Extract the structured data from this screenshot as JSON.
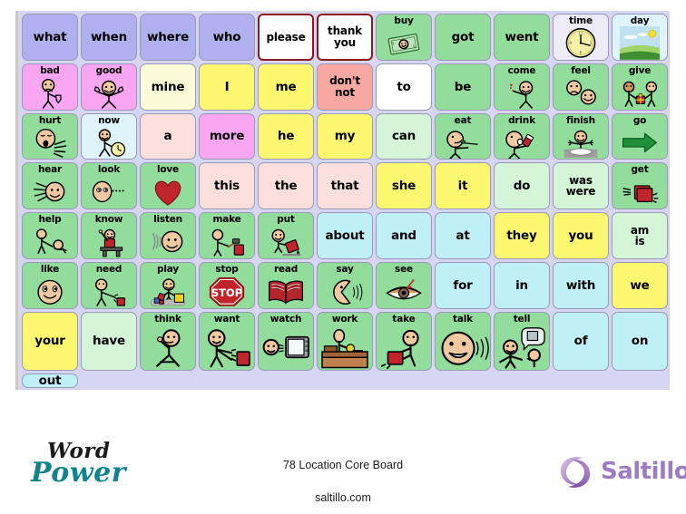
{
  "board": {
    "title": "78 Location Core  Board",
    "url": "saltillo.com",
    "wordpower": {
      "line1": "Word",
      "line2": "Power"
    },
    "brand": {
      "name": "Saltillo"
    },
    "colors": {
      "panel_bg": "#d6d6f2",
      "pronoun_purple": "#b0b0ee",
      "pronoun_yellow": "#fbf86f",
      "pronoun_cream": "#fbfbd8",
      "negation_pink": "#f7a8a3",
      "verb_green": "#92dc9c",
      "helper_green": "#d4f5d8",
      "white": "#ffffff",
      "prep_blue": "#bff0f8",
      "demonstrative_pink": "#fadfdc",
      "descriptor_magenta": "#f8a6f2",
      "time_lavender": "#ecebf7",
      "sky_blue": "#dff3fb",
      "highlight_border": "#8b1a1a"
    },
    "rows": [
      [
        {
          "label": "what",
          "color": "#b0b0ee",
          "pic": null
        },
        {
          "label": "when",
          "color": "#b0b0ee",
          "pic": null
        },
        {
          "label": "where",
          "color": "#b0b0ee",
          "pic": null
        },
        {
          "label": "who",
          "color": "#b0b0ee",
          "pic": null
        },
        {
          "label": "please",
          "color": "#ffffff",
          "pic": null,
          "highlight": true,
          "small": true
        },
        {
          "label": "thank\nyou",
          "color": "#ffffff",
          "pic": null,
          "highlight": true,
          "small": true
        },
        {
          "label": "buy",
          "color": "#92dc9c",
          "pic": "money"
        },
        {
          "label": "got",
          "color": "#92dc9c",
          "pic": null
        },
        {
          "label": "went",
          "color": "#92dc9c",
          "pic": null
        },
        {
          "label": "time",
          "color": "#ecebf7",
          "pic": "clock"
        },
        {
          "label": "day",
          "color": "#dff3fb",
          "pic": "landscape"
        },
        {
          "label": "bad",
          "color": "#f8a6f2",
          "pic": "thumbs-down-person"
        },
        {
          "label": "good",
          "color": "#f8a6f2",
          "pic": "thumbs-up-person"
        }
      ],
      [
        {
          "label": "mine",
          "color": "#fbfbd8",
          "pic": null
        },
        {
          "label": "I",
          "color": "#fbf86f",
          "pic": null
        },
        {
          "label": "me",
          "color": "#fbf86f",
          "pic": null
        },
        {
          "label": "don't\nnot",
          "color": "#f7a8a3",
          "pic": null,
          "small": true
        },
        {
          "label": "to",
          "color": "#ffffff",
          "pic": null
        },
        {
          "label": "be",
          "color": "#92dc9c",
          "pic": null
        },
        {
          "label": "come",
          "color": "#92dc9c",
          "pic": "come-person"
        },
        {
          "label": "feel",
          "color": "#92dc9c",
          "pic": "feel-faces"
        },
        {
          "label": "give",
          "color": "#92dc9c",
          "pic": "give-gift"
        },
        {
          "label": "hurt",
          "color": "#92dc9c",
          "pic": "hurt-face"
        },
        {
          "label": "now",
          "color": "#dff3fb",
          "pic": "now-clock-person"
        },
        {
          "label": "a",
          "color": "#fadfdc",
          "pic": null
        },
        {
          "label": "more",
          "color": "#f8a6f2",
          "pic": null
        }
      ],
      [
        {
          "label": "he",
          "color": "#fbf86f",
          "pic": null
        },
        {
          "label": "my",
          "color": "#fbf86f",
          "pic": null
        },
        {
          "label": "can",
          "color": "#d4f5d8",
          "pic": null
        },
        {
          "label": "eat",
          "color": "#92dc9c",
          "pic": "eat-person"
        },
        {
          "label": "drink",
          "color": "#92dc9c",
          "pic": "drink-person"
        },
        {
          "label": "finish",
          "color": "#92dc9c",
          "pic": "finish-plate"
        },
        {
          "label": "go",
          "color": "#92dc9c",
          "pic": "green-arrow"
        },
        {
          "label": "hear",
          "color": "#92dc9c",
          "pic": "hear-ear"
        },
        {
          "label": "look",
          "color": "#92dc9c",
          "pic": "look-face"
        },
        {
          "label": "love",
          "color": "#92dc9c",
          "pic": "heart"
        },
        {
          "label": "this",
          "color": "#fadfdc",
          "pic": null
        },
        {
          "label": "the",
          "color": "#fadfdc",
          "pic": null
        },
        {
          "label": "that",
          "color": "#fadfdc",
          "pic": null
        }
      ],
      [
        {
          "label": "she",
          "color": "#fbf86f",
          "pic": null
        },
        {
          "label": "it",
          "color": "#fbf86f",
          "pic": null
        },
        {
          "label": "do",
          "color": "#d4f5d8",
          "pic": null
        },
        {
          "label": "was\nwere",
          "color": "#d4f5d8",
          "pic": null,
          "small": true
        },
        {
          "label": "get",
          "color": "#92dc9c",
          "pic": "get-hands-box"
        },
        {
          "label": "help",
          "color": "#92dc9c",
          "pic": "help-people"
        },
        {
          "label": "know",
          "color": "#92dc9c",
          "pic": "know-desk"
        },
        {
          "label": "listen",
          "color": "#92dc9c",
          "pic": "listen-face"
        },
        {
          "label": "make",
          "color": "#92dc9c",
          "pic": "make-hammer"
        },
        {
          "label": "put",
          "color": "#92dc9c",
          "pic": "put-box"
        },
        {
          "label": "about",
          "color": "#bff0f8",
          "pic": null
        },
        {
          "label": "and",
          "color": "#bff0f8",
          "pic": null
        },
        {
          "label": "at",
          "color": "#bff0f8",
          "pic": null
        }
      ],
      [
        {
          "label": "they",
          "color": "#fbf86f",
          "pic": null
        },
        {
          "label": "you",
          "color": "#fbf86f",
          "pic": null
        },
        {
          "label": "am\nis",
          "color": "#d4f5d8",
          "pic": null,
          "small": true
        },
        {
          "label": "like",
          "color": "#92dc9c",
          "pic": "like-smile"
        },
        {
          "label": "need",
          "color": "#92dc9c",
          "pic": "need-person-box"
        },
        {
          "label": "play",
          "color": "#92dc9c",
          "pic": "play-blocks"
        },
        {
          "label": "stop",
          "color": "#92dc9c",
          "pic": "stop-sign"
        },
        {
          "label": "read",
          "color": "#92dc9c",
          "pic": "open-book"
        },
        {
          "label": "say",
          "color": "#92dc9c",
          "pic": "say-mouth"
        },
        {
          "label": "see",
          "color": "#92dc9c",
          "pic": "eye"
        },
        {
          "label": "for",
          "color": "#bff0f8",
          "pic": null
        },
        {
          "label": "in",
          "color": "#bff0f8",
          "pic": null
        },
        {
          "label": "with",
          "color": "#bff0f8",
          "pic": null
        }
      ],
      [
        {
          "label": "we",
          "color": "#fbf86f",
          "pic": null
        },
        {
          "label": "your",
          "color": "#fbf86f",
          "pic": null
        },
        {
          "label": "have",
          "color": "#d4f5d8",
          "pic": null
        },
        {
          "label": "think",
          "color": "#92dc9c",
          "pic": "think-person"
        },
        {
          "label": "want",
          "color": "#92dc9c",
          "pic": "want-person-box"
        },
        {
          "label": "watch",
          "color": "#92dc9c",
          "pic": "watch-tv"
        },
        {
          "label": "work",
          "color": "#92dc9c",
          "pic": "work-desk"
        },
        {
          "label": "take",
          "color": "#92dc9c",
          "pic": "take-person-box"
        },
        {
          "label": "talk",
          "color": "#92dc9c",
          "pic": "talk-face"
        },
        {
          "label": "tell",
          "color": "#92dc9c",
          "pic": "tell-people"
        },
        {
          "label": "of",
          "color": "#bff0f8",
          "pic": null
        },
        {
          "label": "on",
          "color": "#bff0f8",
          "pic": null
        },
        {
          "label": "out",
          "color": "#bff0f8",
          "pic": null
        }
      ]
    ]
  }
}
